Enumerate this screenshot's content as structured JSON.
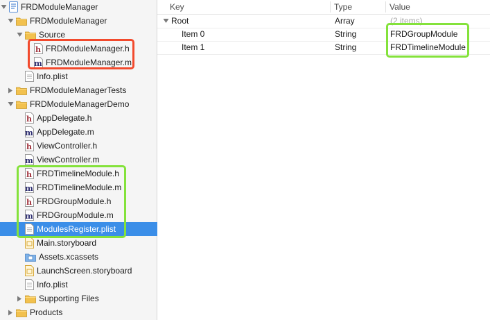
{
  "navigator": {
    "items": [
      {
        "label": "FRDModuleManager",
        "icon": "project-icon",
        "disclosure": "expanded",
        "level": 0
      },
      {
        "label": "FRDModuleManager",
        "icon": "folder-icon",
        "disclosure": "expanded",
        "level": 1
      },
      {
        "label": "Source",
        "icon": "folder-icon",
        "disclosure": "expanded",
        "level": 2
      },
      {
        "label": "FRDModuleManager.h",
        "icon": "header-file-icon",
        "disclosure": "none",
        "level": 3
      },
      {
        "label": "FRDModuleManager.m",
        "icon": "implementation-file-icon",
        "disclosure": "none",
        "level": 3
      },
      {
        "label": "Info.plist",
        "icon": "plist-file-icon",
        "disclosure": "none",
        "level": 2
      },
      {
        "label": "FRDModuleManagerTests",
        "icon": "folder-icon",
        "disclosure": "collapsed",
        "level": 1
      },
      {
        "label": "FRDModuleManagerDemo",
        "icon": "folder-icon",
        "disclosure": "expanded",
        "level": 1
      },
      {
        "label": "AppDelegate.h",
        "icon": "header-file-icon",
        "disclosure": "none",
        "level": 2
      },
      {
        "label": "AppDelegate.m",
        "icon": "implementation-file-icon",
        "disclosure": "none",
        "level": 2
      },
      {
        "label": "ViewController.h",
        "icon": "header-file-icon",
        "disclosure": "none",
        "level": 2
      },
      {
        "label": "ViewController.m",
        "icon": "implementation-file-icon",
        "disclosure": "none",
        "level": 2
      },
      {
        "label": "FRDTimelineModule.h",
        "icon": "header-file-icon",
        "disclosure": "none",
        "level": 2
      },
      {
        "label": "FRDTimelineModule.m",
        "icon": "implementation-file-icon",
        "disclosure": "none",
        "level": 2
      },
      {
        "label": "FRDGroupModule.h",
        "icon": "header-file-icon",
        "disclosure": "none",
        "level": 2
      },
      {
        "label": "FRDGroupModule.m",
        "icon": "implementation-file-icon",
        "disclosure": "none",
        "level": 2
      },
      {
        "label": "ModulesRegister.plist",
        "icon": "plist-file-icon",
        "disclosure": "none",
        "level": 2,
        "selected": true
      },
      {
        "label": "Main.storyboard",
        "icon": "storyboard-icon",
        "disclosure": "none",
        "level": 2
      },
      {
        "label": "Assets.xcassets",
        "icon": "asset-catalog-icon",
        "disclosure": "none",
        "level": 2
      },
      {
        "label": "LaunchScreen.storyboard",
        "icon": "storyboard-icon",
        "disclosure": "none",
        "level": 2
      },
      {
        "label": "Info.plist",
        "icon": "plist-file-icon",
        "disclosure": "none",
        "level": 2
      },
      {
        "label": "Supporting Files",
        "icon": "folder-icon",
        "disclosure": "collapsed",
        "level": 2
      },
      {
        "label": "Products",
        "icon": "folder-icon",
        "disclosure": "collapsed",
        "level": 1
      }
    ]
  },
  "plist": {
    "headers": {
      "key": "Key",
      "type": "Type",
      "value": "Value"
    },
    "rows": [
      {
        "key": "Root",
        "type": "Array",
        "value": "(2 items)",
        "disclosure": "expanded",
        "value_muted": true
      },
      {
        "key": "Item 0",
        "type": "String",
        "value": "FRDGroupModule"
      },
      {
        "key": "Item 1",
        "type": "String",
        "value": "FRDTimelineModule"
      }
    ]
  },
  "colors": {
    "selection": "#3b8ee8",
    "annotation_red": "#f24a2d",
    "annotation_green": "#84e23b",
    "folder": "#f2c14e",
    "header_file": "#a0303a",
    "implementation_file": "#2a2a6e"
  }
}
